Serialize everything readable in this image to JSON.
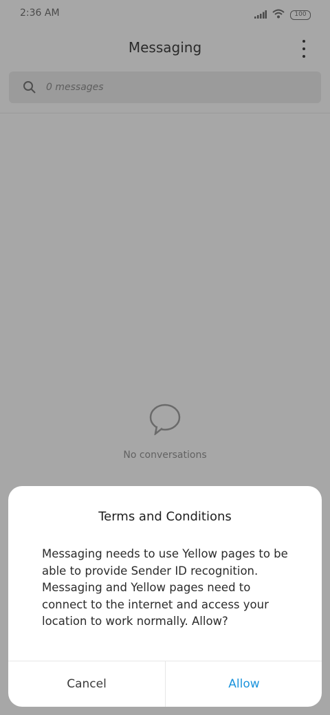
{
  "status_bar": {
    "time": "2:36 AM",
    "battery": "100"
  },
  "header": {
    "title": "Messaging"
  },
  "search": {
    "placeholder": "0 messages"
  },
  "empty_state": {
    "text": "No conversations"
  },
  "dialog": {
    "title": "Terms and Conditions",
    "body": "Messaging needs to use Yellow pages to be able to provide Sender ID recognition. Messaging and Yellow pages need to connect to the internet and access your location to work normally. Allow?",
    "cancel_label": "Cancel",
    "allow_label": "Allow"
  },
  "colors": {
    "accent": "#1a93dc",
    "scrim": "#a7a7a7"
  },
  "icons": [
    "signal-icon",
    "wifi-icon",
    "battery-icon",
    "more-icon",
    "search-icon",
    "chat-bubble-icon"
  ]
}
